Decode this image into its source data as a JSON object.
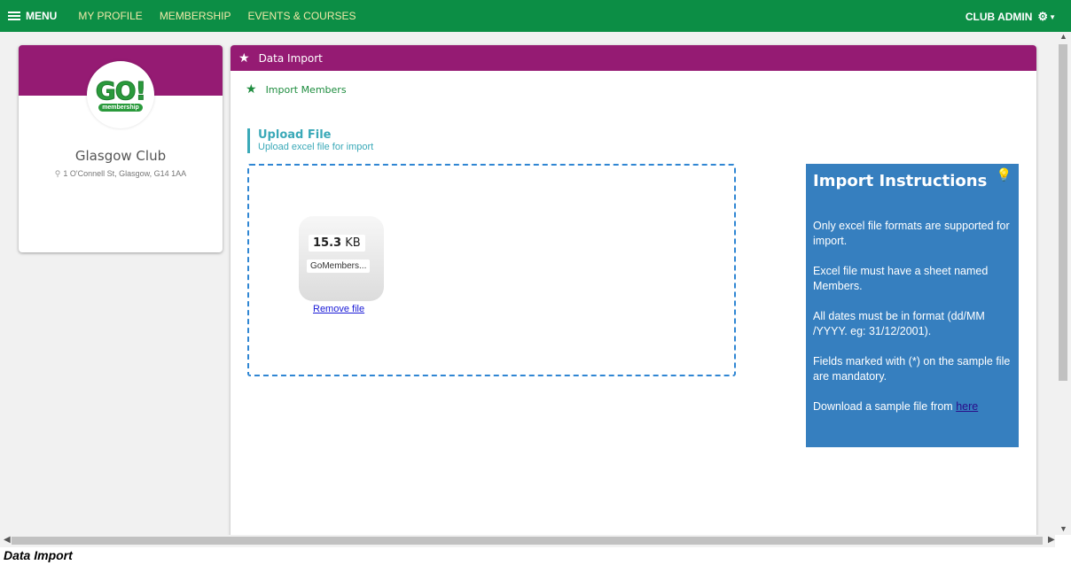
{
  "topbar": {
    "menu_label": "MENU",
    "nav": [
      "MY PROFILE",
      "MEMBERSHIP",
      "EVENTS & COURSES"
    ],
    "user_label": "CLUB ADMIN",
    "bg_color": "#0c8e45"
  },
  "club": {
    "logo_text": "GO!",
    "logo_sub": "membership",
    "name": "Glasgow Club",
    "address": "1 O'Connell St, Glasgow, G14 1AA"
  },
  "panel": {
    "title": "Data Import",
    "sub_link": "Import Members",
    "accent_color": "#951b73"
  },
  "upload": {
    "title": "Upload File",
    "subtitle": "Upload excel file for import",
    "file": {
      "size_value": "15.3",
      "size_unit": "KB",
      "name": "GoMembers..."
    },
    "remove_label": "Remove file"
  },
  "instructions": {
    "title": "Import Instructions",
    "items": [
      "Only excel file formats are supported for import.",
      "Excel file must have a sheet named Members.",
      "All dates must be in format (dd/MM /YYYY. eg: 31/12/2001).",
      "Fields marked with (*) on the sample file are mandatory."
    ],
    "download_text": "Download a sample file from ",
    "download_link": "here",
    "bg_color": "#367fbf"
  },
  "caption": "Data Import"
}
